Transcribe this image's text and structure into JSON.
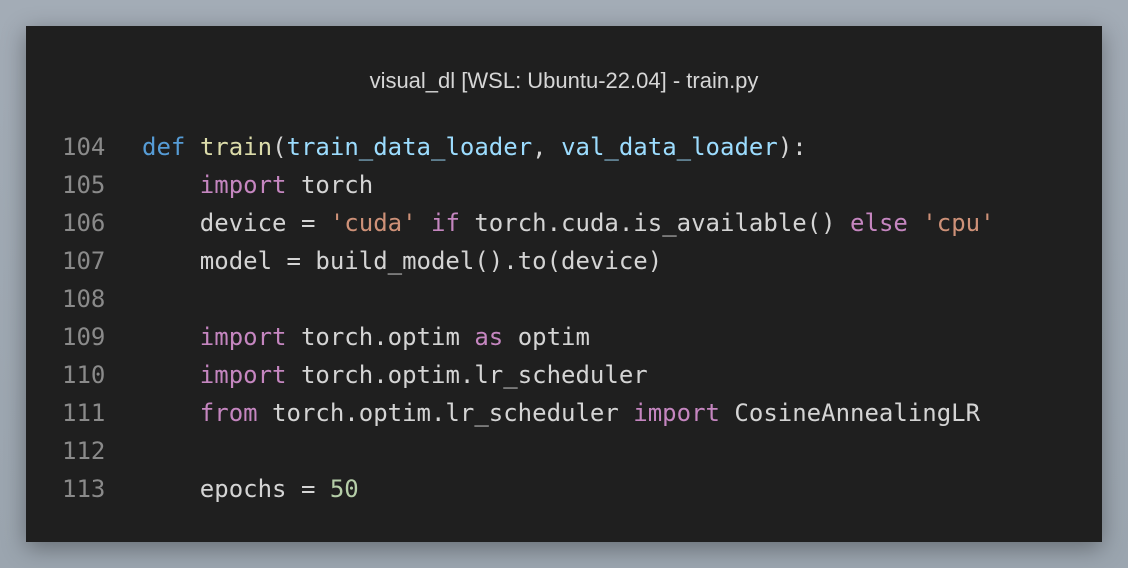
{
  "window": {
    "title": "visual_dl [WSL: Ubuntu-22.04] - train.py"
  },
  "colors": {
    "background": "#1f1f1f",
    "line_number": "#8a8a8a",
    "keyword_def": "#569cd6",
    "keyword_control": "#c586c0",
    "function": "#dcdcaa",
    "parameter": "#9cdcfe",
    "string": "#ce9178",
    "number": "#b5cea8",
    "text": "#d4d4d4"
  },
  "lines": [
    {
      "number": "104",
      "tokens": [
        {
          "t": "def",
          "c": "kw"
        },
        {
          "t": " ",
          "c": "plain"
        },
        {
          "t": "train",
          "c": "fn"
        },
        {
          "t": "(",
          "c": "plain"
        },
        {
          "t": "train_data_loader",
          "c": "param"
        },
        {
          "t": ", ",
          "c": "plain"
        },
        {
          "t": "val_data_loader",
          "c": "param"
        },
        {
          "t": "):",
          "c": "plain"
        }
      ]
    },
    {
      "number": "105",
      "tokens": [
        {
          "t": "    ",
          "c": "plain"
        },
        {
          "t": "import",
          "c": "ctl"
        },
        {
          "t": " torch",
          "c": "plain"
        }
      ]
    },
    {
      "number": "106",
      "tokens": [
        {
          "t": "    device = ",
          "c": "plain"
        },
        {
          "t": "'cuda'",
          "c": "str"
        },
        {
          "t": " ",
          "c": "plain"
        },
        {
          "t": "if",
          "c": "ctl"
        },
        {
          "t": " torch.cuda.is_available() ",
          "c": "plain"
        },
        {
          "t": "else",
          "c": "ctl"
        },
        {
          "t": " ",
          "c": "plain"
        },
        {
          "t": "'cpu'",
          "c": "str"
        }
      ]
    },
    {
      "number": "107",
      "tokens": [
        {
          "t": "    model = build_model().to(device)",
          "c": "plain"
        }
      ]
    },
    {
      "number": "108",
      "tokens": []
    },
    {
      "number": "109",
      "tokens": [
        {
          "t": "    ",
          "c": "plain"
        },
        {
          "t": "import",
          "c": "ctl"
        },
        {
          "t": " torch.optim ",
          "c": "plain"
        },
        {
          "t": "as",
          "c": "ctl"
        },
        {
          "t": " optim",
          "c": "plain"
        }
      ]
    },
    {
      "number": "110",
      "tokens": [
        {
          "t": "    ",
          "c": "plain"
        },
        {
          "t": "import",
          "c": "ctl"
        },
        {
          "t": " torch.optim.lr_scheduler",
          "c": "plain"
        }
      ]
    },
    {
      "number": "111",
      "tokens": [
        {
          "t": "    ",
          "c": "plain"
        },
        {
          "t": "from",
          "c": "ctl"
        },
        {
          "t": " torch.optim.lr_scheduler ",
          "c": "plain"
        },
        {
          "t": "import",
          "c": "ctl"
        },
        {
          "t": " CosineAnnealingLR",
          "c": "cls"
        }
      ]
    },
    {
      "number": "112",
      "tokens": []
    },
    {
      "number": "113",
      "tokens": [
        {
          "t": "    epochs = ",
          "c": "plain"
        },
        {
          "t": "50",
          "c": "num"
        }
      ]
    }
  ]
}
